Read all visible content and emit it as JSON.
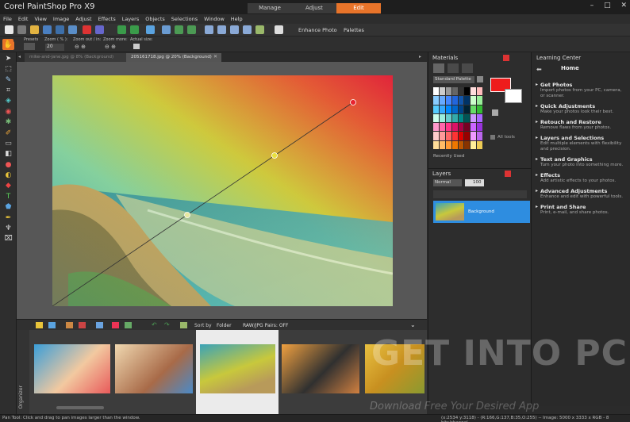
{
  "app": {
    "title": "Corel PaintShop Pro X9",
    "window_controls": [
      "–",
      "□",
      "✕"
    ]
  },
  "workspaces": {
    "tabs": [
      "Manage",
      "Adjust",
      "Edit"
    ],
    "active": "Edit"
  },
  "menu": [
    "File",
    "Edit",
    "View",
    "Image",
    "Adjust",
    "Effects",
    "Layers",
    "Objects",
    "Selections",
    "Window",
    "Help"
  ],
  "toolbar": {
    "enhance_photo": "Enhance Photo",
    "palettes": "Palettes"
  },
  "options": {
    "presets_label": "Presets",
    "zoom_pct_label": "Zoom ( % ):",
    "zoom_pct_value": "20",
    "zoom_out_in_label": "Zoom out / in:",
    "zoom_more_label": "Zoom more:",
    "actual_size_label": "Actual size:"
  },
  "doc_tabs": [
    {
      "label": "mike-and-jane.jpg @  8% (Background)"
    },
    {
      "label": "205161718.jpg @  20% (Background)"
    }
  ],
  "organizer": {
    "label": "Organizer",
    "sort_label": "Sort by",
    "sort_value": "Folder",
    "raw_pairs": "RAW/JPG Pairs: OFF"
  },
  "materials": {
    "title": "Materials",
    "palette": "Standard Palette",
    "all_tools": "All tools",
    "recently_used": "Recently Used",
    "foreground_color": "#ee1c1c",
    "background_color": "#ffffff"
  },
  "layers": {
    "title": "Layers",
    "blend_mode": "Normal",
    "opacity": "100",
    "layer_name": "Background"
  },
  "learning_center": {
    "title": "Learning Center",
    "home": "Home",
    "items": [
      {
        "title": "Get Photos",
        "desc": "Import photos from your PC, camera, or scanner."
      },
      {
        "title": "Quick Adjustments",
        "desc": "Make your photos look their best."
      },
      {
        "title": "Retouch and Restore",
        "desc": "Remove flaws from your photos."
      },
      {
        "title": "Layers and Selections",
        "desc": "Edit multiple elements with flexibility and precision."
      },
      {
        "title": "Text and Graphics",
        "desc": "Turn your photo into something more."
      },
      {
        "title": "Effects",
        "desc": "Add artistic effects to your photos."
      },
      {
        "title": "Advanced Adjustments",
        "desc": "Enhance and edit with powerful tools."
      },
      {
        "title": "Print and Share",
        "desc": "Print, e-mail, and share photos."
      }
    ]
  },
  "status": {
    "left": "Pan Tool: Click and drag to pan images larger than the window.",
    "right": "(x:2534 y:3118) - (R:166,G:137,B:35,O:255) -- Image:  5000 x 3333 x RGB - 8 bits/channel"
  },
  "watermark": {
    "main": "GET INTO PC",
    "sub": "Download Free Your Desired App"
  },
  "colors": {
    "accent": "#e8742a",
    "selection": "#2e8de0"
  }
}
